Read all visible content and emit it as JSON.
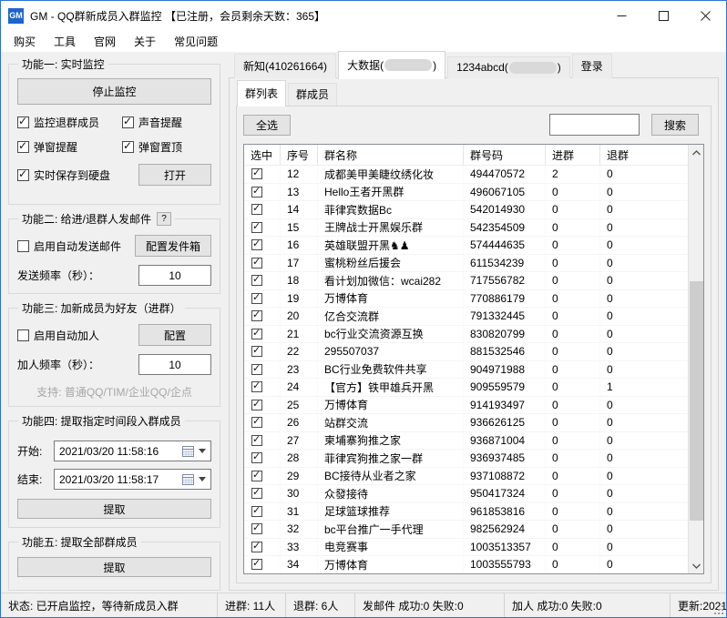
{
  "window": {
    "icon_text": "GM",
    "title": "GM - QQ群新成员入群监控 【已注册，会员剩余天数：365】"
  },
  "menu": {
    "items": [
      "购买",
      "工具",
      "官网",
      "关于",
      "常见问题"
    ]
  },
  "sidebar": {
    "section1": {
      "title": "功能一: 实时监控",
      "stop_button": "停止监控",
      "checkboxes": [
        {
          "label": "监控退群成员",
          "checked": true
        },
        {
          "label": "声音提醒",
          "checked": true
        },
        {
          "label": "弹窗提醒",
          "checked": true
        },
        {
          "label": "弹窗置顶",
          "checked": true
        },
        {
          "label": "实时保存到硬盘",
          "checked": true
        }
      ],
      "open_button": "打开"
    },
    "section2": {
      "title": "功能二: 给进/退群人发邮件",
      "help_label": "?",
      "enable_checkbox": {
        "label": "启用自动发送邮件",
        "checked": false
      },
      "config_button": "配置发件箱",
      "rate_label": "发送频率（秒）：",
      "rate_value": "10"
    },
    "section3": {
      "title": "功能三: 加新成员为好友（进群）",
      "enable_checkbox": {
        "label": "启用自动加人",
        "checked": false
      },
      "config_button": "配置",
      "rate_label": "加人频率（秒）：",
      "rate_value": "10",
      "support_note": "支持: 普通QQ/TIM/企业QQ/企点"
    },
    "section4": {
      "title": "功能四: 提取指定时间段入群成员",
      "start_label": "开始:",
      "start_value": "2021/03/20 11:58:16",
      "end_label": "结束:",
      "end_value": "2021/03/20 11:58:17",
      "extract_button": "提取"
    },
    "section5": {
      "title": "功能五: 提取全部群成员",
      "extract_button": "提取"
    }
  },
  "accounts": {
    "tabs": [
      {
        "label": "新知(410261664)",
        "active": false
      },
      {
        "prefix": "大数据(",
        "suffix": ")",
        "redacted": true,
        "active": true
      },
      {
        "prefix": "1234abcd(",
        "suffix": ")",
        "redacted": true,
        "active": false
      },
      {
        "label": "登录",
        "active": false
      }
    ]
  },
  "content": {
    "tabs": [
      {
        "label": "群列表",
        "active": true
      },
      {
        "label": "群成员",
        "active": false
      }
    ],
    "select_all_button": "全选",
    "search_value": "",
    "search_button": "搜索"
  },
  "table": {
    "headers": [
      "选中",
      "序号",
      "群名称",
      "群号码",
      "进群",
      "退群"
    ],
    "rows": [
      {
        "checked": true,
        "no": "12",
        "name": "成都美甲美睫纹绣化妆",
        "code": "494470572",
        "join": "2",
        "quit": "0"
      },
      {
        "checked": true,
        "no": "13",
        "name": "Hello王者开黑群",
        "code": "496067105",
        "join": "0",
        "quit": "0"
      },
      {
        "checked": true,
        "no": "14",
        "name": "菲律宾数据Bc",
        "code": "542014930",
        "join": "0",
        "quit": "0"
      },
      {
        "checked": true,
        "no": "15",
        "name": "王牌战士开黑娱乐群",
        "code": "542354509",
        "join": "0",
        "quit": "0"
      },
      {
        "checked": true,
        "no": "16",
        "name": "英雄联盟开黑♞♟",
        "code": "574444635",
        "join": "0",
        "quit": "0"
      },
      {
        "checked": true,
        "no": "17",
        "name": "蜜桃粉丝后援会",
        "code": "611534239",
        "join": "0",
        "quit": "0"
      },
      {
        "checked": true,
        "no": "18",
        "name": "看计划加微信：wcai282",
        "code": "717556782",
        "join": "0",
        "quit": "0"
      },
      {
        "checked": true,
        "no": "19",
        "name": "万博体育",
        "code": "770886179",
        "join": "0",
        "quit": "0"
      },
      {
        "checked": true,
        "no": "20",
        "name": "亿合交流群",
        "code": "791332445",
        "join": "0",
        "quit": "0"
      },
      {
        "checked": true,
        "no": "21",
        "name": "bc行业交流资源互换",
        "code": "830820799",
        "join": "0",
        "quit": "0"
      },
      {
        "checked": true,
        "no": "22",
        "name": "295507037",
        "code": "881532546",
        "join": "0",
        "quit": "0"
      },
      {
        "checked": true,
        "no": "23",
        "name": "BC行业免费软件共享",
        "code": "904971988",
        "join": "0",
        "quit": "0"
      },
      {
        "checked": true,
        "no": "24",
        "name": "【官方】铁甲雄兵开黑",
        "code": "909559579",
        "join": "0",
        "quit": "1"
      },
      {
        "checked": true,
        "no": "25",
        "name": "万博体育",
        "code": "914193497",
        "join": "0",
        "quit": "0"
      },
      {
        "checked": true,
        "no": "26",
        "name": "站群交流",
        "code": "936626125",
        "join": "0",
        "quit": "0"
      },
      {
        "checked": true,
        "no": "27",
        "name": "柬埔寨狗推之家",
        "code": "936871004",
        "join": "0",
        "quit": "0"
      },
      {
        "checked": true,
        "no": "28",
        "name": "菲律宾狗推之家一群",
        "code": "936937485",
        "join": "0",
        "quit": "0"
      },
      {
        "checked": true,
        "no": "29",
        "name": "BC接待从业者之家",
        "code": "937108872",
        "join": "0",
        "quit": "0"
      },
      {
        "checked": true,
        "no": "30",
        "name": "众發接待",
        "code": "950417324",
        "join": "0",
        "quit": "0"
      },
      {
        "checked": true,
        "no": "31",
        "name": "足球篮球推荐",
        "code": "961853816",
        "join": "0",
        "quit": "0"
      },
      {
        "checked": true,
        "no": "32",
        "name": "bc平台推广一手代理",
        "code": "982562924",
        "join": "0",
        "quit": "0"
      },
      {
        "checked": true,
        "no": "33",
        "name": "电竞赛事",
        "code": "1003513357",
        "join": "0",
        "quit": "0"
      },
      {
        "checked": true,
        "no": "34",
        "name": "万博体育",
        "code": "1003555793",
        "join": "0",
        "quit": "0"
      }
    ]
  },
  "statusbar": {
    "items": [
      "状态: 已开启监控，等待新成员入群",
      "进群: 11人",
      "退群: 6人",
      "发邮件 成功:0 失败:0",
      "加人 成功:0 失败:0",
      "更新:2021"
    ]
  }
}
